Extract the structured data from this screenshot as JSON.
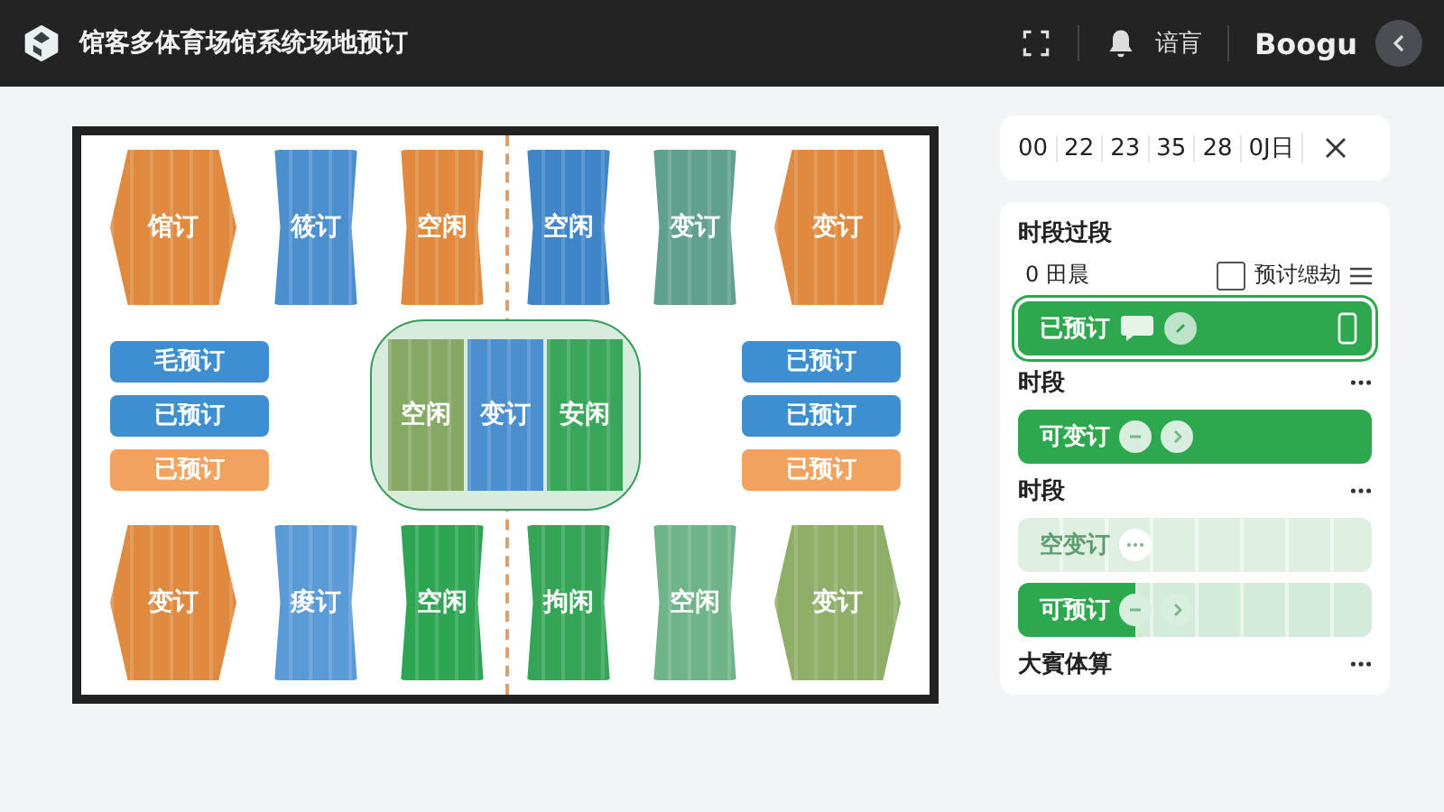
{
  "header": {
    "title": "馆客多体育场馆系统场地预订",
    "language": "谙肓",
    "user": "Boogu"
  },
  "floor_plan": {
    "top_courts": [
      {
        "label": "馆订",
        "color": "#df8a3f",
        "kind": "wide"
      },
      {
        "label": "筱订",
        "color": "#4b8fcf",
        "kind": "narrow"
      },
      {
        "label": "空闲",
        "color": "#df8a3f",
        "kind": "narrow"
      },
      {
        "label": "空闲",
        "color": "#3f86c8",
        "kind": "narrow"
      },
      {
        "label": "变订",
        "color": "#5fa08e",
        "kind": "narrow"
      },
      {
        "label": "变订",
        "color": "#df8a3f",
        "kind": "wide"
      }
    ],
    "left_bookings": [
      {
        "label": "毛预订",
        "color": "#3d8fd1"
      },
      {
        "label": "已预订",
        "color": "#3d8fd1"
      },
      {
        "label": "已预订",
        "color": "#f0a25e"
      }
    ],
    "center_courts": [
      {
        "label": "空闲",
        "color": "#86a865"
      },
      {
        "label": "变订",
        "color": "#4b8fcf"
      },
      {
        "label": "安闲",
        "color": "#3aa65a"
      }
    ],
    "right_bookings": [
      {
        "label": "已预订",
        "color": "#3d8fd1"
      },
      {
        "label": "已预订",
        "color": "#3d8fd1"
      },
      {
        "label": "已预订",
        "color": "#f0a25e"
      }
    ],
    "bottom_courts": [
      {
        "label": "变订",
        "color": "#df8a3f",
        "kind": "wide"
      },
      {
        "label": "痠订",
        "color": "#5a9ad6",
        "kind": "narrow"
      },
      {
        "label": "空闲",
        "color": "#2ea552",
        "kind": "narrow"
      },
      {
        "label": "拘闲",
        "color": "#34a556",
        "kind": "narrow"
      },
      {
        "label": "空闲",
        "color": "#6fb488",
        "kind": "narrow"
      },
      {
        "label": "变订",
        "color": "#8fae68",
        "kind": "wide"
      }
    ]
  },
  "time_picker": {
    "segments": [
      "00",
      "22",
      "23",
      "35",
      "28",
      "0J日"
    ]
  },
  "schedule": {
    "title": "时段过段",
    "count_label": "0 田晨",
    "filter": {
      "label": "预讨缌劫",
      "checked": false
    },
    "items": [
      {
        "kind": "booked",
        "label": "已预订",
        "level": 1,
        "selected": true,
        "disabled": false
      },
      {
        "kind": "heading",
        "label": "时段"
      },
      {
        "kind": "changeable",
        "label": "可变订",
        "level": 1,
        "selected": false,
        "disabled": false
      },
      {
        "kind": "heading",
        "label": "时段"
      },
      {
        "kind": "vacant",
        "label": "空变订",
        "selected": false,
        "disabled": true
      },
      {
        "kind": "available",
        "label": "可预订",
        "level": 0.33,
        "selected": false,
        "disabled": false
      },
      {
        "kind": "heading",
        "label": "大賓体算"
      }
    ]
  }
}
